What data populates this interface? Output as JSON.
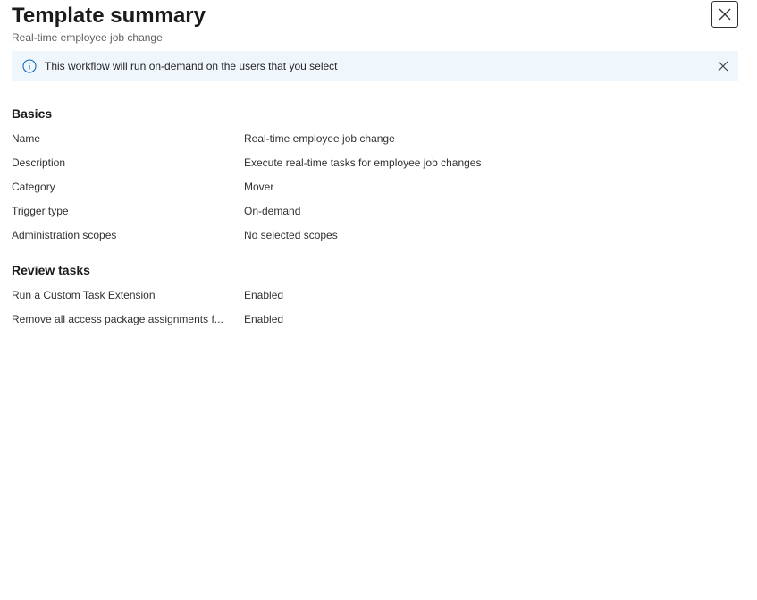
{
  "header": {
    "title": "Template summary",
    "subtitle": "Real-time employee job change",
    "close_icon": "close-icon"
  },
  "banner": {
    "icon": "info-icon",
    "message": "This workflow will run on-demand on the users that you select",
    "dismiss_icon": "dismiss-icon"
  },
  "basics": {
    "heading": "Basics",
    "rows": [
      {
        "label": "Name",
        "value": "Real-time employee job change"
      },
      {
        "label": "Description",
        "value": "Execute real-time tasks for employee job changes"
      },
      {
        "label": "Category",
        "value": "Mover"
      },
      {
        "label": "Trigger type",
        "value": "On-demand"
      },
      {
        "label": "Administration scopes",
        "value": "No selected scopes"
      }
    ]
  },
  "review_tasks": {
    "heading": "Review tasks",
    "rows": [
      {
        "label": "Run a Custom Task Extension",
        "value": "Enabled"
      },
      {
        "label": "Remove all access package assignments f...",
        "value": "Enabled"
      }
    ]
  },
  "colors": {
    "banner_bg": "#eff6fc",
    "info_blue": "#0f6cbd",
    "text": "#242424"
  }
}
